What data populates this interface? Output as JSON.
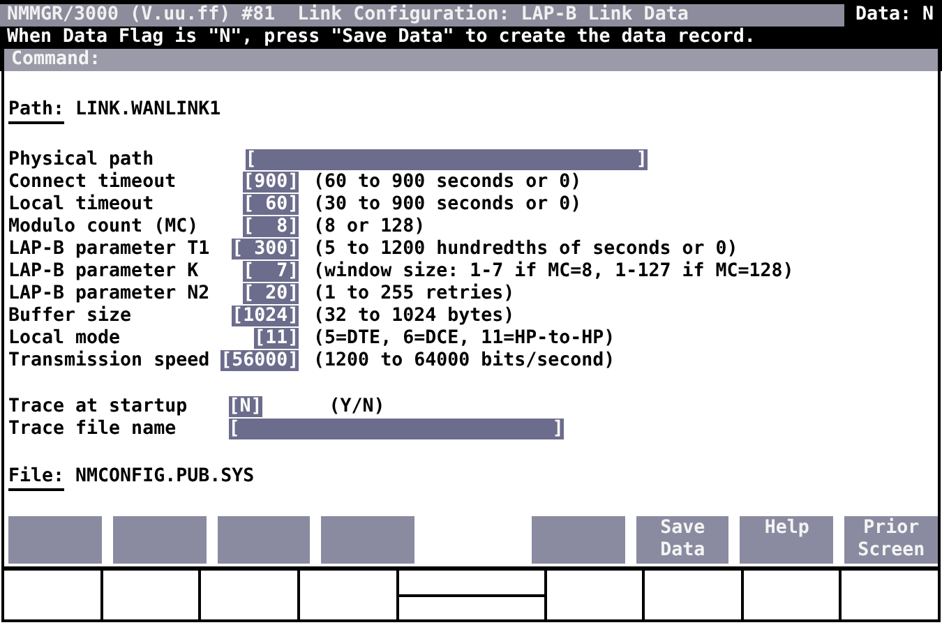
{
  "header": {
    "title": "NMMGR/3000 (V.uu.ff) #81  Link Configuration: LAP-B Link Data",
    "data_flag": "Data: N",
    "message": "When Data Flag is \"N\", press \"Save Data\" to create the data record.",
    "command_label": "Command:"
  },
  "path": {
    "label": "Path:",
    "value": "LINK.WANLINK1"
  },
  "fields": [
    {
      "kind": "long",
      "label": "Physical path",
      "value": "[                                  ]"
    },
    {
      "kind": "short",
      "label": "Connect timeout",
      "value": "[900]",
      "hint": "(60 to 900 seconds or 0)"
    },
    {
      "kind": "short",
      "label": "Local timeout",
      "value": "[ 60]",
      "hint": "(30 to 900 seconds or 0)"
    },
    {
      "kind": "short",
      "label": "Modulo count (MC)",
      "value": "[  8]",
      "hint": "(8 or 128)"
    },
    {
      "kind": "short",
      "label": "LAP-B parameter T1",
      "value": "[ 300]",
      "hint": "(5 to 1200 hundredths of seconds or 0)"
    },
    {
      "kind": "short",
      "label": "LAP-B parameter K",
      "value": "[  7]",
      "hint": "(window size: 1-7 if MC=8, 1-127 if MC=128)"
    },
    {
      "kind": "short",
      "label": "LAP-B parameter N2",
      "value": "[ 20]",
      "hint": "(1 to 255 retries)"
    },
    {
      "kind": "short",
      "label": "Buffer size",
      "value": "[1024]",
      "hint": "(32 to 1024 bytes)"
    },
    {
      "kind": "short",
      "label": "Local mode",
      "value": "[11]",
      "hint": "(5=DTE, 6=DCE, 11=HP-to-HP)"
    },
    {
      "kind": "short",
      "label": "Transmission speed",
      "value": "[56000]",
      "hint": "(1200 to 64000 bits/second)"
    }
  ],
  "trace_fields": [
    {
      "kind": "short",
      "label": "Trace at startup",
      "value": "[N]",
      "hint": "(Y/N)"
    },
    {
      "kind": "long",
      "label": "Trace file name",
      "value": "[                            ]"
    }
  ],
  "file": {
    "label": "File:",
    "value": "NMCONFIG.PUB.SYS"
  },
  "softkeys": [
    {
      "kind": "blank"
    },
    {
      "kind": "blank"
    },
    {
      "kind": "blank"
    },
    {
      "kind": "blank"
    },
    {
      "kind": "gap"
    },
    {
      "kind": "blank"
    },
    {
      "kind": "labeled",
      "lines": [
        "Save",
        "Data"
      ]
    },
    {
      "kind": "labeled",
      "lines": [
        "Help"
      ]
    },
    {
      "kind": "labeled",
      "lines": [
        "Prior",
        "Screen"
      ]
    }
  ]
}
